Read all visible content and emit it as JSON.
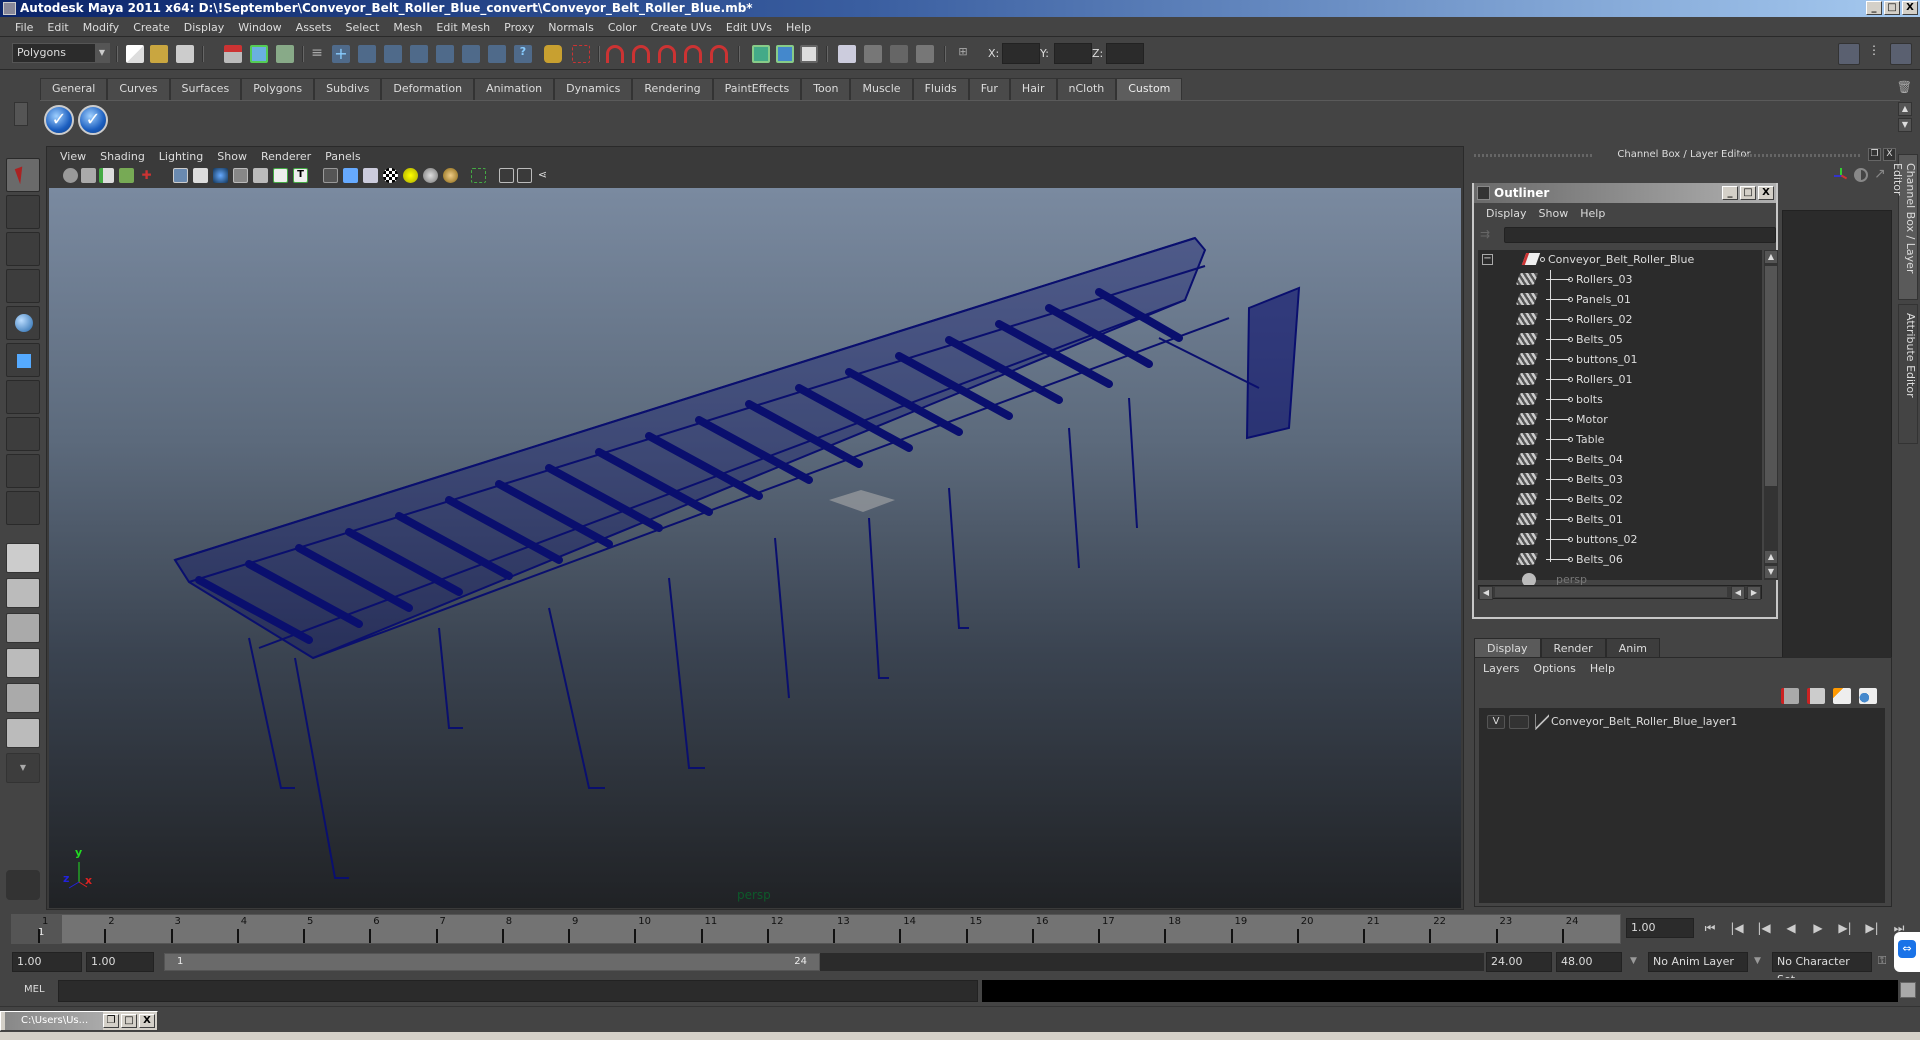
{
  "window": {
    "title": "Autodesk Maya 2011 x64: D:\\!September\\Conveyor_Belt_Roller_Blue_convert\\Conveyor_Belt_Roller_Blue.mb*",
    "controls": {
      "minimize": "_",
      "maximize": "□",
      "close": "X"
    }
  },
  "menubar": [
    "File",
    "Edit",
    "Modify",
    "Create",
    "Display",
    "Window",
    "Assets",
    "Select",
    "Mesh",
    "Edit Mesh",
    "Proxy",
    "Normals",
    "Color",
    "Create UVs",
    "Edit UVs",
    "Help"
  ],
  "toolbar": {
    "mode": "Polygons",
    "coords": {
      "x_label": "X:",
      "y_label": "Y:",
      "z_label": "Z:",
      "x": "",
      "y": "",
      "z": ""
    },
    "icons": [
      "new-scene",
      "open-scene",
      "save-scene",
      "select-hierarchy",
      "select-object",
      "select-component",
      "snap-grid",
      "snap-curve",
      "snap-point",
      "snap-view-plane",
      "make-live",
      "history",
      "render-frame",
      "ipr-render",
      "render-settings",
      "hypershade",
      "lock",
      "select-camera",
      "magnet-1",
      "magnet-2",
      "magnet-3",
      "magnet-4",
      "input-line",
      "output-line",
      "outliner-toggle",
      "render-view",
      "clapper-1",
      "clapper-2",
      "clapper-3"
    ],
    "right_icons": [
      "channel-box-toggle",
      "attribute-toggle",
      "layer-editor-toggle"
    ]
  },
  "shelf": {
    "tabs": [
      "General",
      "Curves",
      "Surfaces",
      "Polygons",
      "Subdivs",
      "Deformation",
      "Animation",
      "Dynamics",
      "Rendering",
      "PaintEffects",
      "Toon",
      "Muscle",
      "Fluids",
      "Fur",
      "Hair",
      "nCloth",
      "Custom"
    ],
    "active_tab": "Custom",
    "buttons": [
      "check-button-1",
      "check-button-2"
    ],
    "check_glyph": "✓"
  },
  "viewport": {
    "menu": [
      "View",
      "Shading",
      "Lighting",
      "Show",
      "Renderer",
      "Panels"
    ],
    "camera": "persp",
    "axis": {
      "x": "x",
      "y": "y",
      "z": "z"
    },
    "wireframe_color": "#0a0f6e"
  },
  "channel_box": {
    "title": "Channel Box / Layer Editor",
    "float_glyph": "❐",
    "close_glyph": "X"
  },
  "side_tabs": [
    "Channel Box / Layer Editor",
    "Attribute Editor"
  ],
  "outliner": {
    "title": "Outliner",
    "menu": [
      "Display",
      "Show",
      "Help"
    ],
    "filter": "",
    "root": "Conveyor_Belt_Roller_Blue",
    "children": [
      "Rollers_03",
      "Panels_01",
      "Rollers_02",
      "Belts_05",
      "buttons_01",
      "Rollers_01",
      "bolts",
      "Motor",
      "Table",
      "Belts_04",
      "Belts_03",
      "Belts_02",
      "Belts_01",
      "buttons_02",
      "Belts_06"
    ],
    "camera_item": "persp",
    "collapse_glyph": "−"
  },
  "layer_editor": {
    "tabs": [
      "Display",
      "Render",
      "Anim"
    ],
    "active_tab": "Display",
    "menu": [
      "Layers",
      "Options",
      "Help"
    ],
    "layers": [
      {
        "visible": "V",
        "name": "Conveyor_Belt_Roller_Blue_layer1"
      }
    ]
  },
  "timeline": {
    "ticks": [
      "1",
      "2",
      "3",
      "4",
      "5",
      "6",
      "7",
      "8",
      "9",
      "10",
      "11",
      "12",
      "13",
      "14",
      "15",
      "16",
      "17",
      "18",
      "19",
      "20",
      "21",
      "22",
      "23",
      "24"
    ],
    "current_marker": "1",
    "current_frame": "1.00",
    "playback": [
      "⏮",
      "|◀",
      "|◀",
      "◀",
      "▶",
      "▶|",
      "▶|",
      "⏭"
    ]
  },
  "range": {
    "start": "1.00",
    "playback_start": "1.00",
    "slider_start": "1",
    "slider_end": "24",
    "playback_end": "24.00",
    "end": "48.00",
    "anim_layer": "No Anim Layer",
    "character_set": "No Character Set"
  },
  "command_line": {
    "label": "MEL",
    "input": "",
    "result": ""
  },
  "taskbar": {
    "label": "C:\\Users\\Us..."
  }
}
